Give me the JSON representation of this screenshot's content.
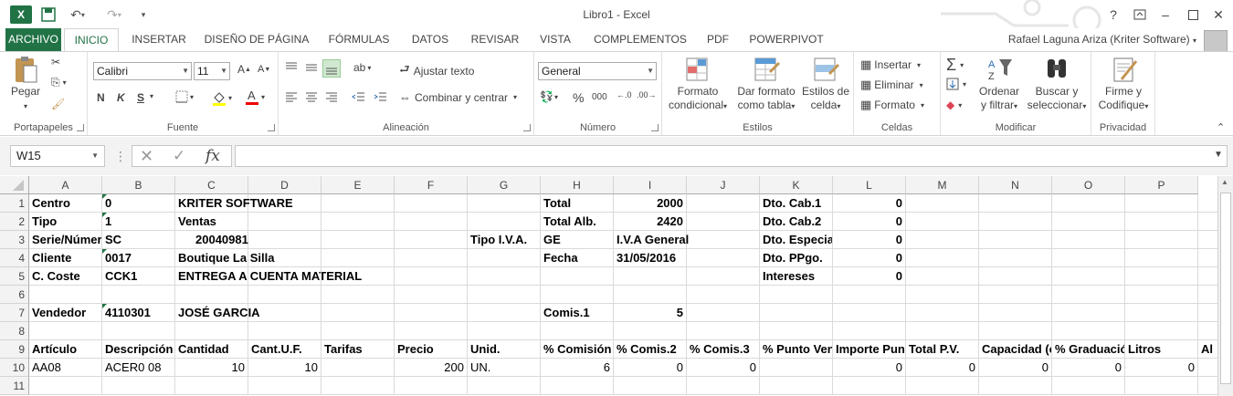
{
  "window": {
    "title": "Libro1 - Excel",
    "help": "?"
  },
  "menu": {
    "tabs": [
      "ARCHIVO",
      "INICIO",
      "INSERTAR",
      "DISEÑO DE PÁGINA",
      "FÓRMULAS",
      "DATOS",
      "REVISAR",
      "VISTA",
      "COMPLEMENTOS",
      "PDF",
      "POWERPIVOT"
    ],
    "user": "Rafael Laguna Ariza (Kriter Software)"
  },
  "ribbon": {
    "clipboard": {
      "label": "Portapapeles",
      "paste": "Pegar"
    },
    "font": {
      "label": "Fuente",
      "name": "Calibri",
      "size": "11",
      "bold": "N",
      "italic": "K",
      "underline": "S"
    },
    "alignment": {
      "label": "Alineación",
      "wrap": "Ajustar texto",
      "merge": "Combinar y centrar"
    },
    "number": {
      "label": "Número",
      "format": "General",
      "percent": "%",
      "thousands": "000"
    },
    "styles": {
      "label": "Estilos",
      "conditional": [
        "Formato",
        "condicional"
      ],
      "table": [
        "Dar formato",
        "como tabla"
      ],
      "cell_styles": [
        "Estilos de",
        "celda"
      ]
    },
    "cells": {
      "label": "Celdas",
      "insert": "Insertar",
      "delete": "Eliminar",
      "format": "Formato"
    },
    "editing": {
      "label": "Modificar",
      "sort": [
        "Ordenar",
        "y filtrar"
      ],
      "find": [
        "Buscar y",
        "seleccionar"
      ]
    },
    "privacy": {
      "label": "Privacidad",
      "sign": [
        "Firme y",
        "Codifique"
      ]
    }
  },
  "formula_bar": {
    "name_box": "W15",
    "formula": "",
    "fx": "fx"
  },
  "columns": [
    "A",
    "B",
    "C",
    "D",
    "E",
    "F",
    "G",
    "H",
    "I",
    "J",
    "K",
    "L",
    "M",
    "N",
    "O",
    "P"
  ],
  "rows": [
    [
      "Centro",
      "0",
      "KRITER SOFTWARE",
      "",
      "",
      "",
      "",
      "Total",
      "2000",
      "",
      "Dto. Cab.1",
      "0",
      "",
      "",
      "",
      "",
      ""
    ],
    [
      "Tipo",
      "1",
      "Ventas",
      "",
      "",
      "",
      "",
      "Total Alb.",
      "2420",
      "",
      "Dto. Cab.2",
      "0",
      "",
      "",
      "",
      "",
      ""
    ],
    [
      "Serie/Número",
      "SC",
      "20040981",
      "",
      "",
      "",
      "Tipo I.V.A.",
      "GE",
      "I.V.A General",
      "",
      "Dto. Especial",
      "0",
      "",
      "",
      "",
      "",
      ""
    ],
    [
      "Cliente",
      "0017",
      "Boutique La Silla",
      "",
      "",
      "",
      "",
      "Fecha",
      "31/05/2016",
      "",
      "Dto. PPgo.",
      "0",
      "",
      "",
      "",
      "",
      ""
    ],
    [
      "C. Coste",
      "CCK1",
      "ENTREGA A CUENTA MATERIAL",
      "",
      "",
      "",
      "",
      "",
      "",
      "",
      "Intereses",
      "0",
      "",
      "",
      "",
      "",
      ""
    ],
    [
      "",
      "",
      "",
      "",
      "",
      "",
      "",
      "",
      "",
      "",
      "",
      "",
      "",
      "",
      "",
      "",
      ""
    ],
    [
      "Vendedor",
      "4110301",
      "JOSÉ GARCIA",
      "",
      "",
      "",
      "",
      "Comis.1",
      "5",
      "",
      "",
      "",
      "",
      "",
      "",
      "",
      ""
    ],
    [
      "",
      "",
      "",
      "",
      "",
      "",
      "",
      "",
      "",
      "",
      "",
      "",
      "",
      "",
      "",
      "",
      ""
    ],
    [
      "Artículo",
      "Descripción Artículo",
      "Cantidad",
      "Cant.U.F.",
      "Tarifas",
      "Precio",
      "Unid.",
      "% Comisión",
      "% Comis.2",
      "% Comis.3",
      "% Punto Venta",
      "Importe Punto Venta",
      "Total P.V.",
      "Capacidad (cl)",
      "% Graduación",
      "Litros",
      "Al"
    ],
    [
      "AA08",
      "ACER0 08",
      "10",
      "10",
      "",
      "200",
      "UN.",
      "6",
      "0",
      "0",
      "",
      "0",
      "0",
      "0",
      "0",
      "0",
      ""
    ],
    [
      "",
      "",
      "",
      "",
      "",
      "",
      "",
      "",
      "",
      "",
      "",
      "",
      "",
      "",
      "",
      "",
      ""
    ]
  ]
}
